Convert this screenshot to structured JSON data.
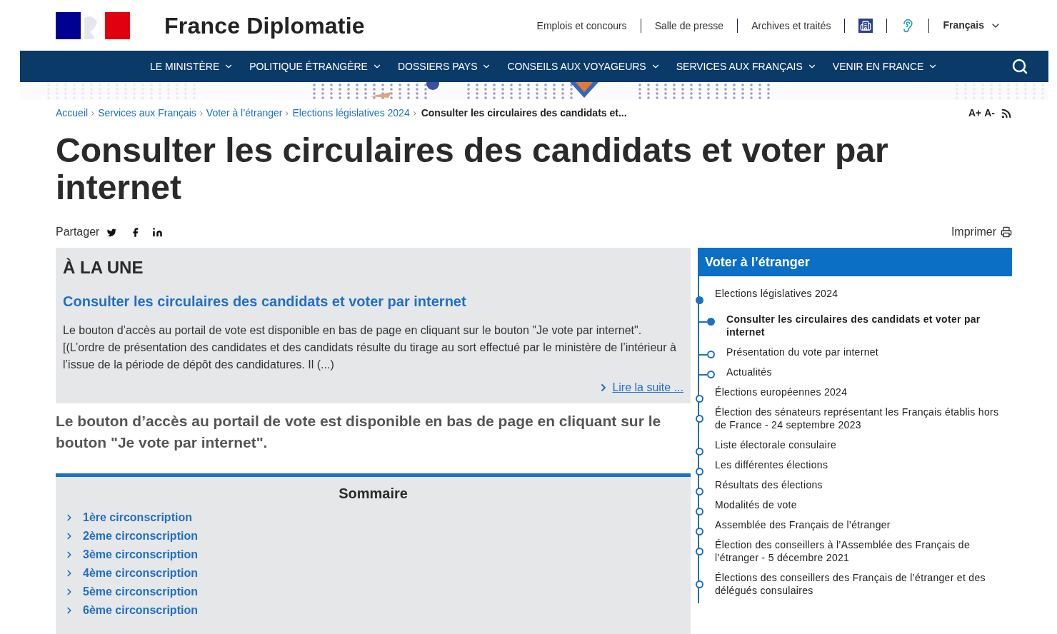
{
  "header": {
    "site_title": "France Diplomatie",
    "top_links": [
      "Emplois et concours",
      "Salle de presse",
      "Archives et traités"
    ],
    "language": "Français"
  },
  "nav": {
    "items": [
      "LE MINISTÈRE",
      "POLITIQUE ÉTRANGÈRE",
      "DOSSIERS PAYS",
      "CONSEILS AUX VOYAGEURS",
      "SERVICES AUX FRANÇAIS",
      "VENIR EN FRANCE"
    ]
  },
  "breadcrumb": {
    "links": [
      "Accueil",
      "Services aux Français",
      "Voter à l’étranger",
      "Elections législatives 2024"
    ],
    "current": "Consulter les circulaires des candidats et...",
    "text_tools": [
      "A+",
      "A-"
    ]
  },
  "page": {
    "title": "Consulter les circulaires des candidats et voter par internet",
    "share_label": "Partager",
    "print_label": "Imprimer"
  },
  "featured": {
    "heading": "À LA UNE",
    "title": "Consulter les circulaires des candidats et voter par internet",
    "text": "Le bouton d’accès au portail de vote est disponible en bas de page en cliquant sur le bouton \"Je vote par internet\". [(L’ordre de présentation des candidates et des candidats résulte du tirage au sort effectué par le ministère de l’intérieur à l’issue de la période de dépôt des candidatures. Il (...)",
    "read_more": "Lire la suite ..."
  },
  "lead": "Le bouton d’accès au portail de vote est disponible en bas de page en cliquant sur le bouton \"Je vote par internet\".",
  "summary": {
    "title": "Sommaire",
    "items": [
      "1ère circonscription",
      "2ème circonscription",
      "3ème circonscription",
      "4ème circonscription",
      "5ème circonscription",
      "6ème circonscription"
    ]
  },
  "sidebar": {
    "title": "Voter à l’étranger",
    "items": [
      {
        "label": "Elections législatives 2024",
        "selected": true,
        "children": [
          {
            "label": "Consulter les circulaires des candidats et voter par internet",
            "selected": true
          },
          {
            "label": "Présentation du vote par internet",
            "selected": false
          },
          {
            "label": "Actualités",
            "selected": false
          }
        ]
      },
      {
        "label": "Élections européennes 2024",
        "selected": false
      },
      {
        "label": "Élection des sénateurs représentant les Français établis hors de France - 24 septembre 2023",
        "selected": false
      },
      {
        "label": "Liste électorale consulaire",
        "selected": false
      },
      {
        "label": "Les différentes élections",
        "selected": false
      },
      {
        "label": "Résultats des élections",
        "selected": false
      },
      {
        "label": "Modalités de vote",
        "selected": false
      },
      {
        "label": "Assemblée des Français de l’étranger",
        "selected": false
      },
      {
        "label": "Élection des conseillers à l’Assemblée des Français de l’étranger - 5 décembre 2021",
        "selected": false
      },
      {
        "label": "Élections des conseillers des Français de l’étranger et des délégués consulaires",
        "selected": false
      }
    ]
  }
}
